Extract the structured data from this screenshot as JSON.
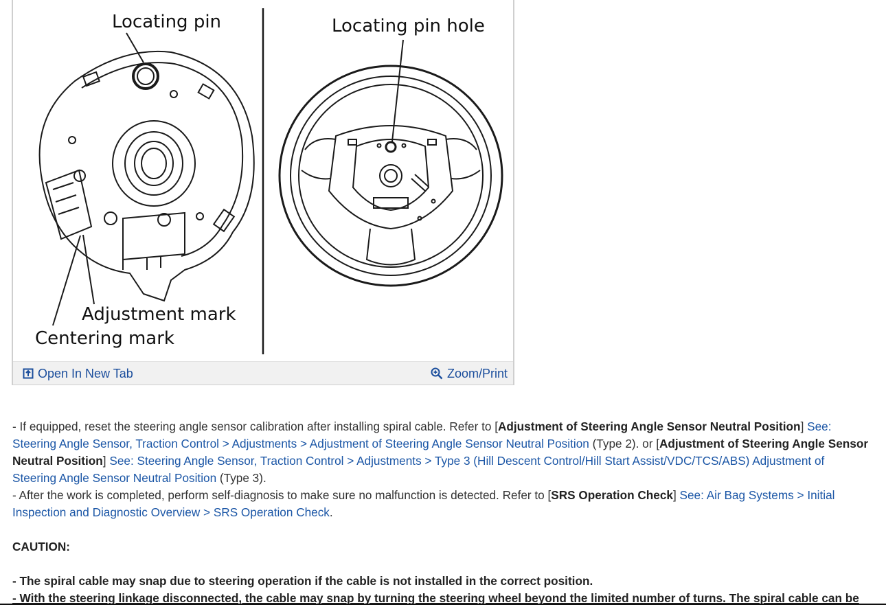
{
  "figure": {
    "labels": {
      "locating_pin": "Locating pin",
      "locating_pin_hole": "Locating pin hole",
      "adjustment_mark": "Adjustment mark",
      "centering_mark": "Centering mark"
    },
    "toolbar": {
      "open_new_tab": "Open In New Tab",
      "zoom_print": "Zoom/Print"
    }
  },
  "body": {
    "p1": {
      "t1": "-  If equipped, reset the steering angle sensor calibration after installing spiral cable. Refer to [",
      "b1": "Adjustment of Steering Angle Sensor Neutral Position",
      "t2": "] ",
      "l1": "See: Steering Angle Sensor, Traction Control > Adjustments > Adjustment of Steering Angle Sensor Neutral Position",
      "t3": " (Type 2). or [",
      "b2": "Adjustment of Steering Angle Sensor Neutral Position",
      "t4": "] ",
      "l2": "See: Steering Angle Sensor, Traction Control > Adjustments > Type 3 (Hill Descent Control/Hill Start Assist/VDC/TCS/ABS) Adjustment of Steering Angle Sensor Neutral Position",
      "t5": " (Type 3)."
    },
    "p2": {
      "t1": "-  After the work is completed, perform self-diagnosis to make sure no malfunction is detected. Refer to [",
      "b1": "SRS Operation Check",
      "t2": "] ",
      "l1": "See: Air Bag Systems > Initial Inspection and Diagnostic Overview > SRS Operation Check",
      "t3": "."
    },
    "caution_title": "CAUTION:",
    "caution_1": "-  The spiral cable may snap due to steering operation if the cable is not installed in the correct position.",
    "caution_2": "-  With the steering linkage disconnected, the cable may snap by turning the steering wheel beyond the limited number of turns. The spiral cable can be"
  }
}
